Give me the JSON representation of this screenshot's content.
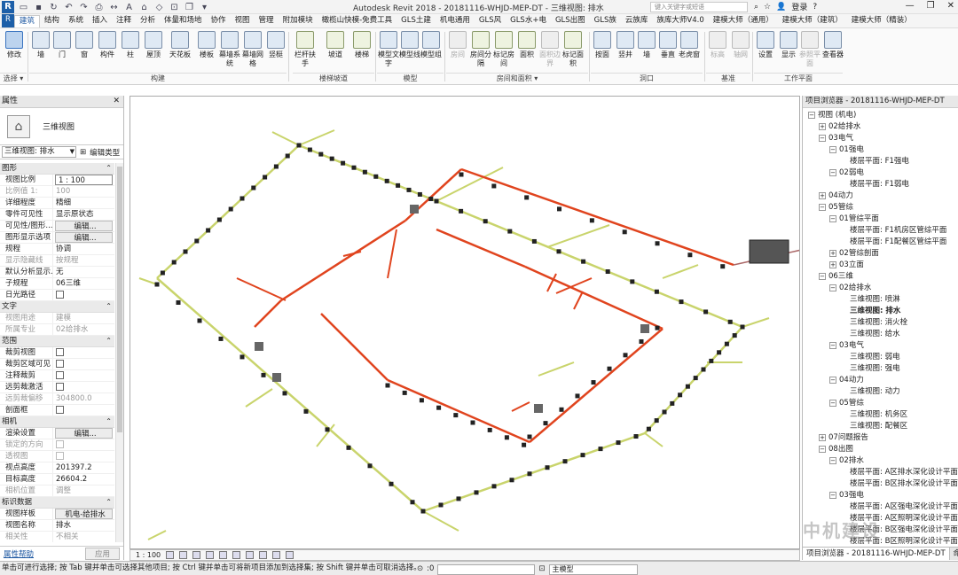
{
  "window": {
    "title": "Autodesk Revit 2018 -   20181116-WHJD-MEP-DT - 三维视图: 排水",
    "search_placeholder": "键入关键字或短语",
    "login": "登录"
  },
  "tabs": [
    "建筑",
    "结构",
    "系统",
    "插入",
    "注释",
    "分析",
    "体量和场地",
    "协作",
    "视图",
    "管理",
    "附加模块",
    "橄榄山快模-免费工具",
    "GLS土建",
    "机电通用",
    "GLS风",
    "GLS水+电",
    "GLS出图",
    "GLS族",
    "云族库",
    "族库大师V4.0",
    "建模大师（通用）",
    "建模大师（建筑）",
    "建模大师（精装）"
  ],
  "ribbon": {
    "modify": "修改",
    "select": "选择 ▾",
    "build": [
      "墙",
      "门",
      "窗",
      "构件",
      "柱",
      "屋顶",
      "天花板",
      "楼板",
      "幕墙系统",
      "幕墙网格",
      "竖梃"
    ],
    "build_panel": "构建",
    "circ": [
      "栏杆扶手",
      "坡道",
      "楼梯"
    ],
    "circ_panel": "楼梯坡道",
    "model": [
      "模型文字",
      "模型线",
      "模型组"
    ],
    "model_panel": "模型",
    "room": [
      "房间",
      "房间分隔",
      "标记房间",
      "面积",
      "面积边界",
      "标记面积"
    ],
    "room_panel": "房间和面积 ▾",
    "open": [
      "按面",
      "竖井",
      "墙",
      "垂直",
      "老虎窗"
    ],
    "open_panel": "洞口",
    "datum": [
      "标高",
      "轴网"
    ],
    "datum_panel": "基准",
    "work": [
      "设置",
      "显示",
      "参照平面",
      "查看器"
    ],
    "work_panel": "工作平面"
  },
  "props": {
    "header": "属性",
    "type_name": "三维视图",
    "type_select": "三维视图: 排水",
    "edit_type": "编辑类型",
    "sections": [
      {
        "title": "图形",
        "rows": [
          [
            "视图比例",
            "1 : 100",
            "inp"
          ],
          [
            "比例值 1:",
            "100",
            "dim"
          ],
          [
            "详细程度",
            "精细",
            ""
          ],
          [
            "零件可见性",
            "显示原状态",
            ""
          ],
          [
            "可见性/图形...",
            "编辑...",
            "btn"
          ],
          [
            "图形显示选项",
            "编辑...",
            "btn"
          ],
          [
            "规程",
            "协调",
            ""
          ],
          [
            "显示隐藏线",
            "按规程",
            "dim"
          ],
          [
            "默认分析显示...",
            "无",
            ""
          ],
          [
            "子规程",
            "06三维",
            ""
          ],
          [
            "日光路径",
            "",
            "cb"
          ]
        ]
      },
      {
        "title": "文字",
        "rows": [
          [
            "视图用途",
            "建模",
            "dim"
          ],
          [
            "所属专业",
            "02给排水",
            "dim"
          ]
        ]
      },
      {
        "title": "范围",
        "rows": [
          [
            "裁剪视图",
            "",
            "cb"
          ],
          [
            "裁剪区域可见",
            "",
            "cb"
          ],
          [
            "注释裁剪",
            "",
            "cb"
          ],
          [
            "远剪裁激活",
            "",
            "cb"
          ],
          [
            "远剪裁偏移",
            "304800.0",
            "dim"
          ],
          [
            "剖面框",
            "",
            "cb"
          ]
        ]
      },
      {
        "title": "相机",
        "rows": [
          [
            "渲染设置",
            "编辑...",
            "btn"
          ],
          [
            "锁定的方向",
            "",
            "cbd"
          ],
          [
            "透视图",
            "",
            "cbd"
          ],
          [
            "视点高度",
            "201397.2",
            ""
          ],
          [
            "目标高度",
            "26604.2",
            ""
          ],
          [
            "相机位置",
            "调整",
            "dim"
          ]
        ]
      },
      {
        "title": "标识数据",
        "rows": [
          [
            "视图样板",
            "机电-给排水",
            "btn"
          ],
          [
            "视图名称",
            "排水",
            ""
          ],
          [
            "相关性",
            "不相关",
            "dim"
          ],
          [
            "图纸上的标题",
            "",
            ""
          ]
        ]
      }
    ],
    "help": "属性帮助",
    "apply": "应用"
  },
  "view_status": {
    "scale": "1 : 100"
  },
  "browser": {
    "title": "项目浏览器 - 20181116-WHJD-MEP-DT",
    "tree": [
      [
        0,
        "−",
        "视图 (机电)"
      ],
      [
        1,
        "+",
        "02给排水"
      ],
      [
        1,
        "−",
        "03电气"
      ],
      [
        2,
        "−",
        "01强电"
      ],
      [
        3,
        "",
        "楼层平面: F1强电"
      ],
      [
        2,
        "−",
        "02弱电"
      ],
      [
        3,
        "",
        "楼层平面: F1弱电"
      ],
      [
        1,
        "+",
        "04动力"
      ],
      [
        1,
        "−",
        "05管综"
      ],
      [
        2,
        "−",
        "01管综平面"
      ],
      [
        3,
        "",
        "楼层平面: F1机房区管综平面"
      ],
      [
        3,
        "",
        "楼层平面: F1配餐区管综平面"
      ],
      [
        2,
        "+",
        "02管综剖面"
      ],
      [
        2,
        "+",
        "03立面"
      ],
      [
        1,
        "−",
        "06三维"
      ],
      [
        2,
        "−",
        "02给排水"
      ],
      [
        3,
        "",
        "三维视图: 喷淋"
      ],
      [
        3,
        "",
        "三维视图: 排水",
        "b"
      ],
      [
        3,
        "",
        "三维视图: 消火栓"
      ],
      [
        3,
        "",
        "三维视图: 给水"
      ],
      [
        2,
        "−",
        "03电气"
      ],
      [
        3,
        "",
        "三维视图: 弱电"
      ],
      [
        3,
        "",
        "三维视图: 强电"
      ],
      [
        2,
        "−",
        "04动力"
      ],
      [
        3,
        "",
        "三维视图: 动力"
      ],
      [
        2,
        "−",
        "05管综"
      ],
      [
        3,
        "",
        "三维视图: 机务区"
      ],
      [
        3,
        "",
        "三维视图: 配餐区"
      ],
      [
        1,
        "+",
        "07问题报告"
      ],
      [
        1,
        "−",
        "08出图"
      ],
      [
        2,
        "−",
        "02排水"
      ],
      [
        3,
        "",
        "楼层平面: A区排水深化设计平面图"
      ],
      [
        3,
        "",
        "楼层平面: B区排水深化设计平面图"
      ],
      [
        2,
        "−",
        "03强电"
      ],
      [
        3,
        "",
        "楼层平面: A区强电深化设计平面图"
      ],
      [
        3,
        "",
        "楼层平面: A区照明深化设计平面图"
      ],
      [
        3,
        "",
        "楼层平面: B区强电深化设计平面图"
      ],
      [
        3,
        "",
        "楼层平面: B区照明深化设计平面图"
      ],
      [
        2,
        "−",
        "04弱电"
      ]
    ],
    "tab1": "项目浏览器 - 20181116-WHJD-MEP-DT",
    "tab2": "命令搜"
  },
  "status": {
    "text": "单击可进行选择; 按 Tab 键并单击可选择其他项目; 按 Ctrl 键并单击可将新项目添加到选择集; 按 Shift 键并单击可取消选择。",
    "model": "主模型",
    "zero": ":0"
  },
  "watermark": "中机建设"
}
